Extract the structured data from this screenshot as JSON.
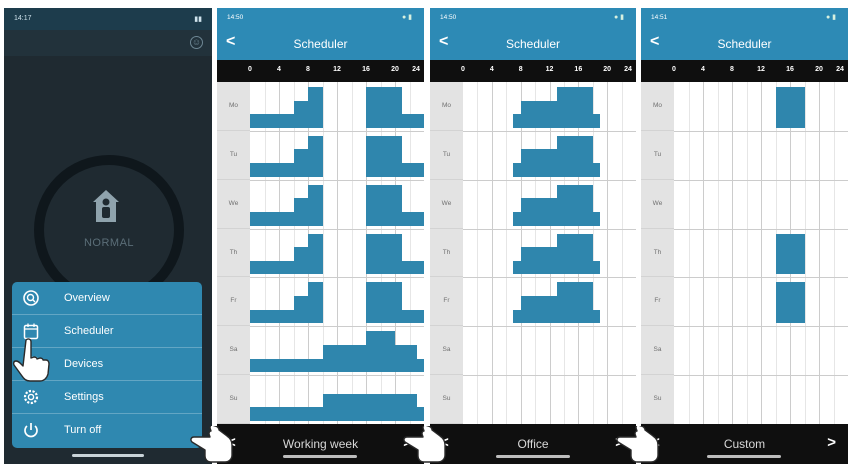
{
  "main_screen": {
    "time": "14:17",
    "mode": "NORMAL",
    "menu": [
      {
        "label": "Overview",
        "icon": "overview-icon"
      },
      {
        "label": "Scheduler",
        "icon": "calendar-icon"
      },
      {
        "label": "Devices",
        "icon": "devices-icon"
      },
      {
        "label": "Settings",
        "icon": "gear-icon"
      },
      {
        "label": "Turn off",
        "icon": "power-icon"
      }
    ]
  },
  "scheduler": {
    "title": "Scheduler",
    "back": "<",
    "next": ">",
    "hours": [
      "0",
      "4",
      "8",
      "12",
      "16",
      "20",
      "24"
    ],
    "days": [
      "Mo",
      "Tu",
      "We",
      "Th",
      "Fr",
      "Sa",
      "Su"
    ],
    "colors": {
      "bar": "#2f86ad",
      "header": "#2d8ab5"
    },
    "screens": [
      {
        "time": "14:50",
        "program_name": "Working week",
        "schedule": [
          [
            [
              0,
              6,
              1
            ],
            [
              6,
              8,
              2
            ],
            [
              8,
              10,
              3
            ],
            [
              16,
              21,
              3
            ],
            [
              21,
              24,
              1
            ]
          ],
          [
            [
              0,
              6,
              1
            ],
            [
              6,
              8,
              2
            ],
            [
              8,
              10,
              3
            ],
            [
              16,
              21,
              3
            ],
            [
              21,
              24,
              1
            ]
          ],
          [
            [
              0,
              6,
              1
            ],
            [
              6,
              8,
              2
            ],
            [
              8,
              10,
              3
            ],
            [
              16,
              21,
              3
            ],
            [
              21,
              24,
              1
            ]
          ],
          [
            [
              0,
              6,
              1
            ],
            [
              6,
              8,
              2
            ],
            [
              8,
              10,
              3
            ],
            [
              16,
              21,
              3
            ],
            [
              21,
              24,
              1
            ]
          ],
          [
            [
              0,
              6,
              1
            ],
            [
              6,
              8,
              2
            ],
            [
              8,
              10,
              3
            ],
            [
              16,
              21,
              3
            ],
            [
              21,
              24,
              1
            ]
          ],
          [
            [
              0,
              10,
              1
            ],
            [
              10,
              16,
              2
            ],
            [
              16,
              20,
              3
            ],
            [
              20,
              23,
              2
            ],
            [
              23,
              24,
              1
            ]
          ],
          [
            [
              0,
              10,
              1
            ],
            [
              10,
              23,
              2
            ],
            [
              23,
              24,
              1
            ]
          ]
        ]
      },
      {
        "time": "14:50",
        "program_name": "Office",
        "schedule": [
          [
            [
              7,
              8,
              1
            ],
            [
              8,
              13,
              2
            ],
            [
              13,
              18,
              3
            ],
            [
              18,
              19,
              1
            ]
          ],
          [
            [
              7,
              8,
              1
            ],
            [
              8,
              13,
              2
            ],
            [
              13,
              18,
              3
            ],
            [
              18,
              19,
              1
            ]
          ],
          [
            [
              7,
              8,
              1
            ],
            [
              8,
              13,
              2
            ],
            [
              13,
              18,
              3
            ],
            [
              18,
              19,
              1
            ]
          ],
          [
            [
              7,
              8,
              1
            ],
            [
              8,
              13,
              2
            ],
            [
              13,
              18,
              3
            ],
            [
              18,
              19,
              1
            ]
          ],
          [
            [
              7,
              8,
              1
            ],
            [
              8,
              13,
              2
            ],
            [
              13,
              18,
              3
            ],
            [
              18,
              19,
              1
            ]
          ],
          [],
          []
        ]
      },
      {
        "time": "14:51",
        "program_name": "Custom",
        "schedule": [
          [
            [
              14,
              18,
              3
            ]
          ],
          [],
          [],
          [
            [
              14,
              18,
              3
            ]
          ],
          [
            [
              14,
              18,
              3
            ]
          ],
          [],
          []
        ]
      }
    ]
  }
}
